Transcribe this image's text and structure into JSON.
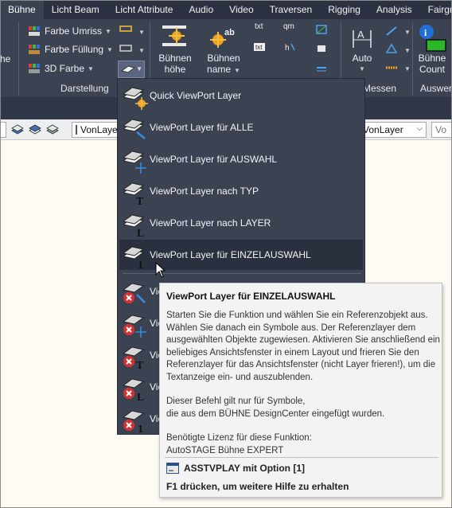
{
  "tabs": [
    "Bühne",
    "Licht Beam",
    "Licht Attribute",
    "Audio",
    "Video",
    "Traversen",
    "Rigging",
    "Analysis",
    "Fairgr"
  ],
  "ribbon": {
    "left_cut_label": "he",
    "colors": {
      "umriss": "Farbe Umriss",
      "fuellung": "Farbe Füllung",
      "farbe3d": "3D Farbe"
    },
    "darstellung_title": "Darstellung",
    "buehnen_hoehe": [
      "Bühnen",
      "höhe"
    ],
    "buehnen_name": [
      "Bühnen",
      "name"
    ],
    "txt_label": "txt",
    "mm_label": "qm",
    "auto_label": "Auto",
    "messen_title": "Messen",
    "buehne_count": [
      "Bühne",
      "Count"
    ],
    "auswert_title": "Auswer"
  },
  "toolbar": {
    "layer_combo": "VonLayer",
    "layer_combo2": "VonLayer",
    "combo3": "Vo"
  },
  "menu": {
    "items": [
      {
        "label": "Quick ViewPort Layer",
        "icon": "quick-viewport-layer-icon"
      },
      {
        "label": "ViewPort Layer für ALLE",
        "icon": "viewport-layer-all-icon"
      },
      {
        "label": "ViewPort Layer für AUSWAHL",
        "icon": "viewport-layer-selection-icon"
      },
      {
        "label": "ViewPort Layer nach TYP",
        "icon": "viewport-layer-type-icon"
      },
      {
        "label": "ViewPort Layer nach LAYER",
        "icon": "viewport-layer-layer-icon"
      },
      {
        "label": "ViewPort Layer für EINZELAUSWAHL",
        "icon": "viewport-layer-single-icon"
      }
    ],
    "remove_items": [
      {
        "label": "Vie",
        "icon": "remove-viewport-layer-all-icon"
      },
      {
        "label": "Vie",
        "icon": "remove-viewport-layer-selection-icon"
      },
      {
        "label": "Vie",
        "icon": "remove-viewport-layer-type-icon"
      },
      {
        "label": "Vie",
        "icon": "remove-viewport-layer-layer-icon"
      },
      {
        "label": "Vie",
        "icon": "remove-viewport-layer-single-icon"
      }
    ]
  },
  "tooltip": {
    "title": "ViewPort Layer für EINZELAUSWAHL",
    "paragraph1": "Starten Sie die Funktion und wählen Sie ein Referenzobjekt aus. Wählen Sie danach ein Symbole aus. Der Referenzlayer dem ausgewählten Objekte zugewiesen. Aktivieren Sie anschließend ein beliebiges Ansichtsfenster in einem Layout und frieren Sie den Referenzlayer für das Ansichtsfenster (nicht Layer frieren!), um die Textanzeige ein- und auszublenden.",
    "paragraph2a": "Dieser Befehl gilt nur für Symbole,",
    "paragraph2b": "die aus dem BÜHNE DesignCenter eingefügt wurden.",
    "paragraph3a": "Benötigte Lizenz für diese Funktion:",
    "paragraph3b": "AutoSTAGE Bühne EXPERT",
    "command": "ASSTVPLAY mit Option [1]",
    "help": "F1 drücken, um weitere Hilfe zu erhalten"
  },
  "colors": {
    "ribbon_bg": "#3b4353",
    "tab_bar_bg": "#2b3140",
    "menu_hover": "#2a303d",
    "tooltip_bg": "#f3f3f3",
    "canvas_bg": "#fdfbf2"
  }
}
